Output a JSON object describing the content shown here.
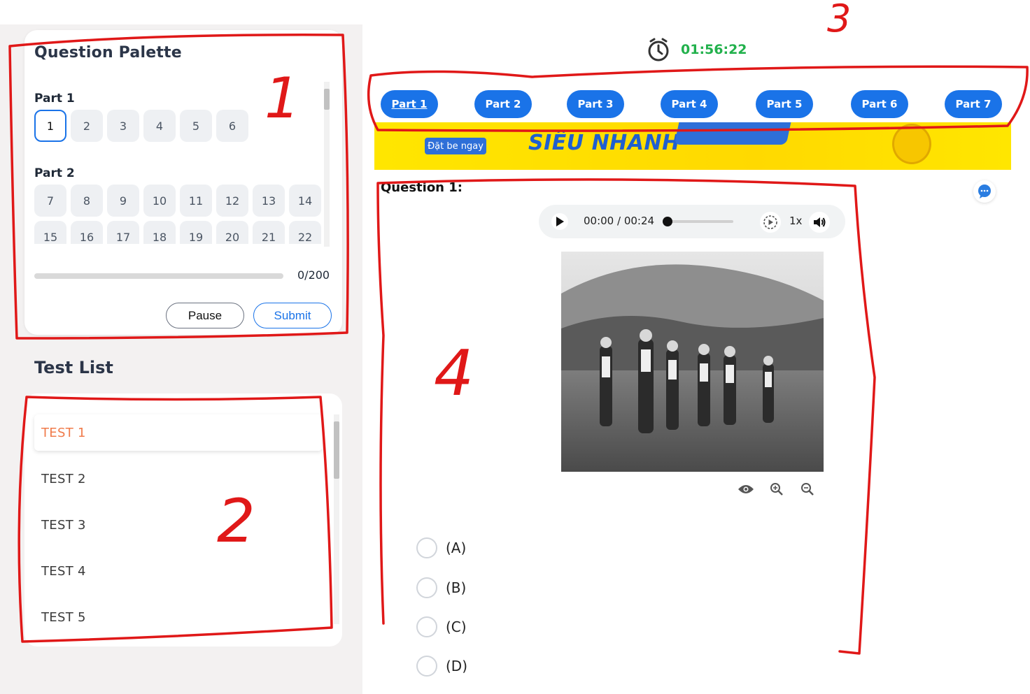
{
  "palette": {
    "title": "Question Palette",
    "parts": [
      {
        "label": "Part 1",
        "questions": [
          "1",
          "2",
          "3",
          "4",
          "5",
          "6"
        ]
      },
      {
        "label": "Part 2",
        "questions": [
          "7",
          "8",
          "9",
          "10",
          "11",
          "12",
          "13",
          "14",
          "15",
          "16",
          "17",
          "18",
          "19",
          "20",
          "21",
          "22"
        ]
      }
    ],
    "active_question": "1",
    "progress_text": "0/200",
    "progress_fraction": 0,
    "pause_label": "Pause",
    "submit_label": "Submit"
  },
  "test_list": {
    "title": "Test List",
    "items": [
      "TEST 1",
      "TEST 2",
      "TEST 3",
      "TEST 4",
      "TEST 5"
    ],
    "active_index": 0
  },
  "timer": {
    "text": "01:56:22",
    "color": "#22b14c"
  },
  "part_tabs": [
    "Part 1",
    "Part 2",
    "Part 3",
    "Part 4",
    "Part 5",
    "Part 6",
    "Part 7"
  ],
  "banner": {
    "tag": "Đặt be ngay",
    "headline": "SIÊU NHANH"
  },
  "question": {
    "label": "Question 1:"
  },
  "audio": {
    "time": "00:00 / 00:24",
    "speed": "1x"
  },
  "options": [
    "(A)",
    "(B)",
    "(C)",
    "(D)"
  ],
  "annotations": [
    "1",
    "2",
    "3",
    "4"
  ],
  "colors": {
    "accent": "#1a73e8",
    "active_test": "#f07b4b",
    "annotation": "#e01818"
  }
}
